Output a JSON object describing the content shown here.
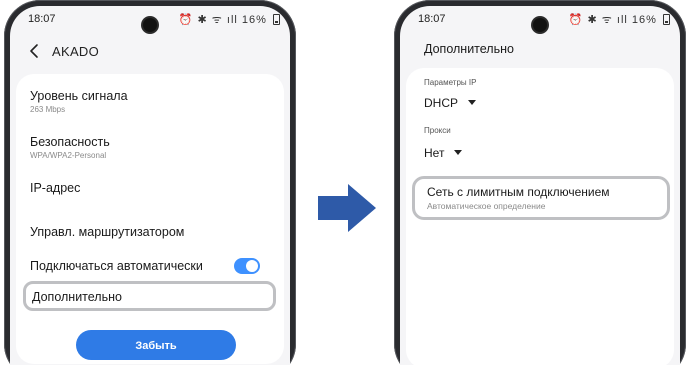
{
  "status": {
    "time": "18:07",
    "battery": "16%",
    "icons": "⏰ ✱ ᯤ ıll"
  },
  "left_screen": {
    "network_name": "AKADO",
    "items": [
      {
        "title": "Уровень сигнала",
        "subtitle": "263 Mbps"
      },
      {
        "title": "Безопасность",
        "subtitle": "WPA/WPA2-Personal"
      },
      {
        "title": "IP-адрес",
        "subtitle": ""
      },
      {
        "title": "Управл. маршрутизатором",
        "subtitle": ""
      },
      {
        "title": "Подключаться автоматически",
        "subtitle": ""
      },
      {
        "title": "Дополнительно",
        "subtitle": ""
      }
    ],
    "auto_connect_on": true,
    "forget_label": "Забыть"
  },
  "right_screen": {
    "title": "Дополнительно",
    "ip_settings_label": "Параметры IP",
    "ip_settings_value": "DHCP",
    "proxy_label": "Прокси",
    "proxy_value": "Нет",
    "metered_title": "Сеть с лимитным подключением",
    "metered_subtitle": "Автоматическое определение"
  },
  "colors": {
    "accent": "#2f7be6",
    "toggle": "#3e91ff",
    "arrow": "#2e5aa8",
    "highlight": "#bfc0c3"
  }
}
